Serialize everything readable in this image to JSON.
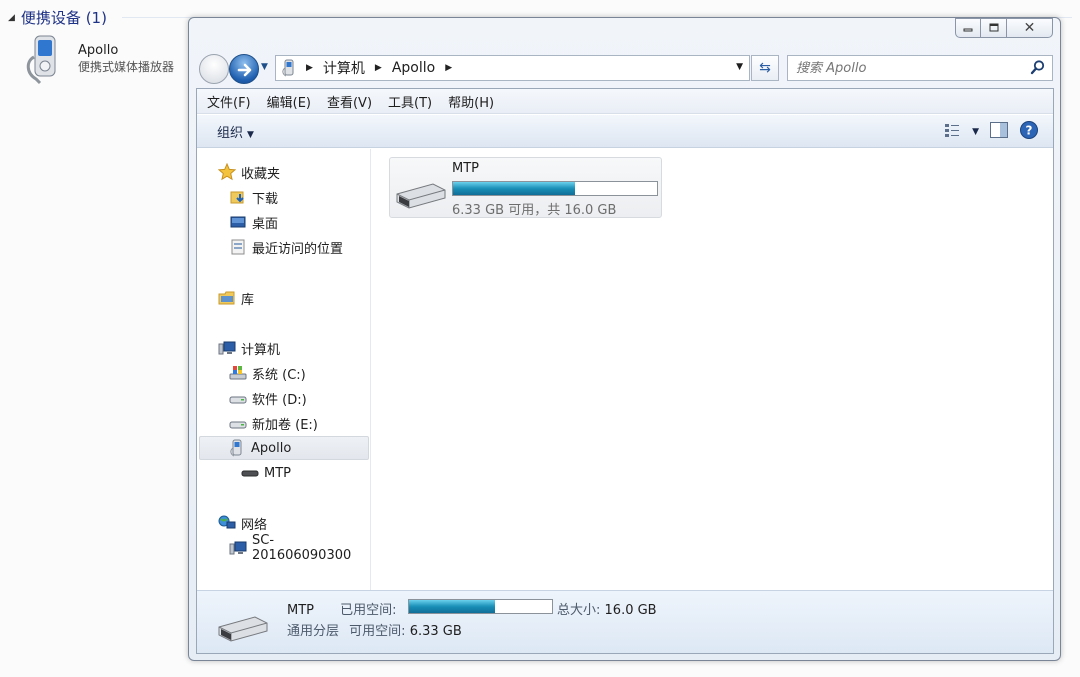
{
  "background": {
    "group_header": "便携设备 (1)",
    "device_name": "Apollo",
    "device_type": "便携式媒体播放器"
  },
  "window": {
    "address": {
      "segments": [
        "计算机",
        "Apollo"
      ]
    },
    "search": {
      "placeholder": "搜索 Apollo"
    },
    "menu": [
      "文件(F)",
      "编辑(E)",
      "查看(V)",
      "工具(T)",
      "帮助(H)"
    ],
    "toolbar": {
      "organize_label": "组织"
    },
    "nav": {
      "favorites": {
        "label": "收藏夹",
        "items": [
          "下载",
          "桌面",
          "最近访问的位置"
        ]
      },
      "libraries": {
        "label": "库"
      },
      "computer": {
        "label": "计算机",
        "items": [
          "系统 (C:)",
          "软件 (D:)",
          "新加卷 (E:)"
        ]
      },
      "device": {
        "label": "Apollo",
        "child": "MTP"
      },
      "network": {
        "label": "网络",
        "items": [
          "SC-201606090300"
        ]
      }
    },
    "content": {
      "storage_name": "MTP",
      "storage_free_text": "6.33 GB 可用，共 16.0 GB",
      "used_fraction": 0.6
    },
    "details": {
      "name": "MTP",
      "used_label": "已用空间:",
      "total_label": "总大小:",
      "total_value": "16.0 GB",
      "category": "通用分层",
      "free_label": "可用空间:",
      "free_value": "6.33 GB"
    }
  },
  "colors": {
    "accent_blue": "#1f5fb0",
    "bar_fill": "#1a8fb7",
    "header_text": "#1e3287"
  }
}
